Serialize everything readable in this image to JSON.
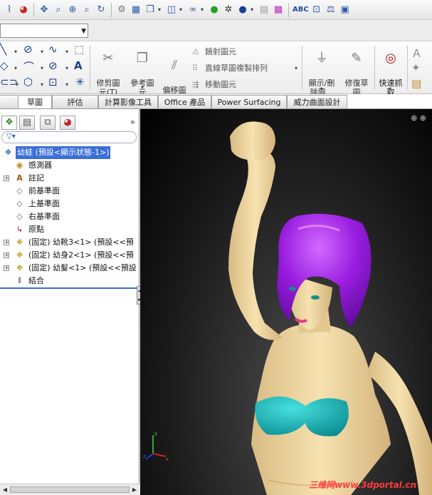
{
  "toolbar": {
    "icons": [
      "curve-icon",
      "color-wheel-icon",
      "pan-icon",
      "zoom-to-fit-icon",
      "zoom-area-icon",
      "zoom-select-icon",
      "rotate-icon",
      "hide-show-icon",
      "sectional-view-icon",
      "view-orientation-icon",
      "display-style-icon",
      "hide-items-icon",
      "edit-appearance-icon",
      "apply-scene-icon",
      "view-settings-icon",
      "shadows-icon",
      "realview-icon",
      "spell-check-icon",
      "tolerance-icon",
      "balance-icon",
      "document-properties-icon"
    ],
    "spell_label": "ABC"
  },
  "ribbon": {
    "trim": "修剪圖\n元(T)",
    "convert": "參考圖\n元",
    "offset": "偏移圖\n元",
    "mirror": "鏡射圖元",
    "linear_pattern": "直線草圖複製排列",
    "move": "移動圖元",
    "show_delete": "顯示/刪\n除限...",
    "repair": "修復草\n圖",
    "quick_snaps": "快速抓\n取"
  },
  "tabs": [
    "草圖",
    "評估",
    "計算影像工具",
    "Office 產品",
    "Power Surfacing",
    "威力曲面設計"
  ],
  "tree": {
    "root": "幼蛙 (預設<顯示狀態-1>)",
    "sensors": "感測器",
    "annotations": "註記",
    "front_plane": "前基準面",
    "top_plane": "上基準面",
    "right_plane": "右基準面",
    "origin": "原點",
    "part1": "(固定) 幼靴3<1> (預設<<預",
    "part2": "(固定) 幼身2<1> (預設<<預",
    "part3": "(固定) 幼髮<1> (預設<<預設",
    "mates": "結合"
  },
  "viewport": {
    "watermark": "三维网www.3dportal.cn",
    "triad": {
      "x": "x",
      "y": "y",
      "z": "z"
    }
  },
  "colors": {
    "hair": "#a822e8",
    "skin": "#f0d8a4",
    "bikini": "#1ab0b0",
    "selection": "#3a6fd8"
  }
}
